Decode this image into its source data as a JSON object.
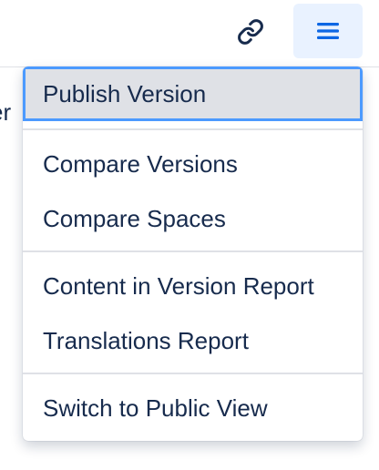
{
  "header": {
    "link_icon": "link-icon",
    "menu_icon": "hamburger-menu-icon",
    "accent_color": "#e9f2ff"
  },
  "background": {
    "partial_text": "er"
  },
  "dropdown": {
    "groups": [
      {
        "items": [
          {
            "label": "Publish Version",
            "active": true
          }
        ]
      },
      {
        "items": [
          {
            "label": "Compare Versions"
          },
          {
            "label": "Compare Spaces"
          }
        ]
      },
      {
        "items": [
          {
            "label": "Content in Version Report"
          },
          {
            "label": "Translations Report"
          }
        ]
      },
      {
        "items": [
          {
            "label": "Switch to Public View"
          }
        ]
      }
    ],
    "active_color": "#dfe1e6",
    "focus_color": "#4c9aff"
  }
}
